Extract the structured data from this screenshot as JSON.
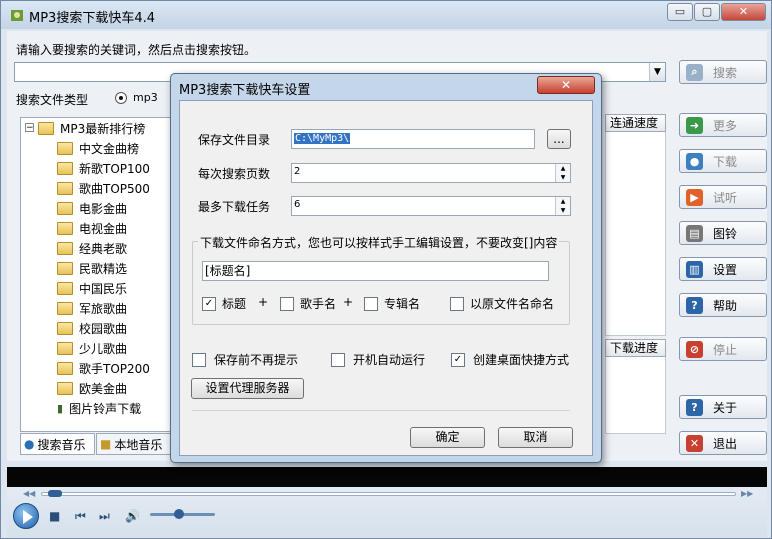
{
  "window": {
    "title": "MP3搜索下载快车4.4",
    "controls": {
      "minimize": "▭",
      "maximize": "▢",
      "close": "✕"
    }
  },
  "main": {
    "prompt": "请输入要搜索的关键词，然后点击搜索按钮。",
    "search_value": "",
    "file_type_label": "搜索文件类型",
    "file_type_selected": "mp3",
    "grid_headers": {
      "speed": "连通速度",
      "progress": "下载进度"
    }
  },
  "side_buttons": [
    {
      "label": "搜索",
      "icon": "search-icon",
      "enabled": false
    },
    {
      "label": "更多",
      "icon": "arrow-right-icon",
      "enabled": false
    },
    {
      "label": "下载",
      "icon": "globe-icon",
      "enabled": false
    },
    {
      "label": "试听",
      "icon": "play-icon",
      "enabled": false
    },
    {
      "label": "图铃",
      "icon": "phone-icon",
      "enabled": true
    },
    {
      "label": "设置",
      "icon": "settings-icon",
      "enabled": true
    },
    {
      "label": "帮助",
      "icon": "help-icon",
      "enabled": true
    },
    {
      "label": "停止",
      "icon": "stop-icon",
      "enabled": false
    },
    {
      "label": "关于",
      "icon": "info-icon",
      "enabled": true
    },
    {
      "label": "退出",
      "icon": "exit-icon",
      "enabled": true
    }
  ],
  "tree": {
    "root": "MP3最新排行榜",
    "items": [
      "中文金曲榜",
      "新歌TOP100",
      "歌曲TOP500",
      "电影金曲",
      "电视金曲",
      "经典老歌",
      "民歌精选",
      "中国民乐",
      "军旅歌曲",
      "校园歌曲",
      "少儿歌曲",
      "歌手TOP200",
      "欧美金曲",
      "图片铃声下载"
    ]
  },
  "tabs": [
    "搜索音乐",
    "本地音乐"
  ],
  "dialog": {
    "title": "MP3搜索下载快车设置",
    "save_dir_label": "保存文件目录",
    "save_dir_value": "C:\\MyMp3\\",
    "browse_label": "...",
    "pages_label": "每次搜索页数",
    "pages_value": "2",
    "tasks_label": "最多下载任务",
    "tasks_value": "6",
    "rename_group_label": "下载文件命名方式，您也可以按样式手工编辑设置，不要改变[]内容",
    "rename_pattern": "[标题名]",
    "opt_title": "标题",
    "opt_singer": "歌手名",
    "opt_album": "专辑名",
    "opt_original": "以原文件名命名",
    "plus": "+",
    "chk_no_prompt": "保存前不再提示",
    "chk_autorun": "开机自动运行",
    "chk_shortcut": "创建桌面快捷方式",
    "checked": {
      "title": true,
      "singer": false,
      "album": false,
      "original": false,
      "no_prompt": false,
      "autorun": false,
      "shortcut": true
    },
    "proxy_button": "设置代理服务器",
    "ok": "确定",
    "cancel": "取消",
    "close": "✕"
  },
  "player": {
    "seek_position": 0.01,
    "volume": 0.45
  },
  "colors": {
    "accent": "#1f5fa7",
    "close_red": "#c8402f"
  }
}
